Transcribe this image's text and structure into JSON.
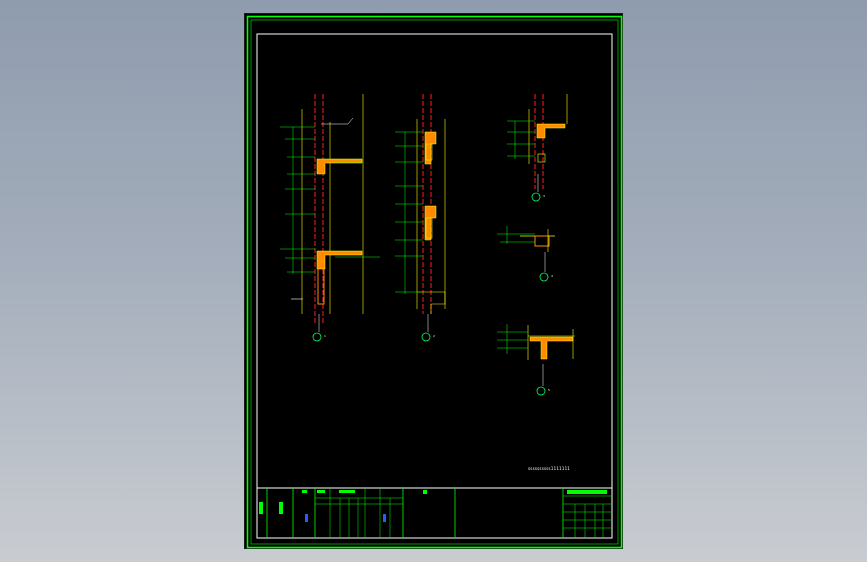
{
  "viewer": {
    "background_top": "#8f9cae",
    "background_bottom": "#c9ccd1"
  },
  "sheet": {
    "background": "#000000",
    "frame_color": "#00ff00",
    "inner_frame_color": "#ffffff"
  },
  "colors": {
    "axis_line": "#ff2020",
    "structure_line": "#ffff00",
    "section_fill": "#ff8c00",
    "dimension_line": "#00ff00",
    "text": "#ffffff",
    "symbol": "#00ff66"
  },
  "details": [
    {
      "id": "detail-1",
      "marker": "1"
    },
    {
      "id": "detail-2",
      "marker": "2"
    },
    {
      "id": "detail-3",
      "marker": "3"
    },
    {
      "id": "detail-4",
      "marker": "4"
    },
    {
      "id": "detail-5",
      "marker": "5"
    }
  ],
  "notes": {
    "bottom_right": "ssssssssss1111111"
  }
}
